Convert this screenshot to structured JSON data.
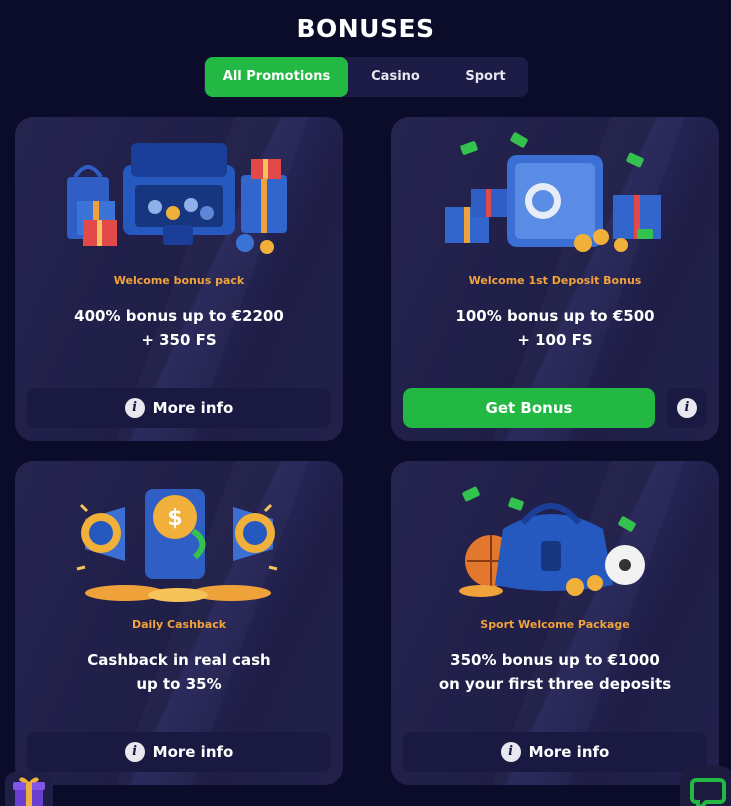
{
  "page": {
    "title": "BONUSES"
  },
  "tabs": [
    {
      "label": "All Promotions",
      "active": true
    },
    {
      "label": "Casino",
      "active": false
    },
    {
      "label": "Sport",
      "active": false
    }
  ],
  "cards": [
    {
      "label": "Welcome bonus pack",
      "line1": "400% bonus up to €2200",
      "line2": "+ 350 FS",
      "button": "More info",
      "illustration": "suitcase-gifts-icon"
    },
    {
      "label": "Welcome 1st Deposit Bonus",
      "line1": "100% bonus up to €500",
      "line2": "+ 100 FS",
      "button": "Get Bonus",
      "info_icon": "info-icon",
      "illustration": "safe-gifts-icon"
    },
    {
      "label": "Daily Cashback",
      "line1": "Cashback in real cash",
      "line2": "up to 35%",
      "button": "More info",
      "illustration": "megaphone-coins-icon"
    },
    {
      "label": "Sport Welcome Package",
      "line1": "350% bonus up to €1000",
      "line2": "on your first three deposits",
      "button": "More info",
      "illustration": "sport-bag-icon"
    }
  ],
  "info_glyph": "i",
  "widgets": {
    "gift": "gift-icon",
    "chat": "chat-icon"
  },
  "colors": {
    "background": "#0b0b2a",
    "accent_green": "#22b843",
    "label_orange": "#f2a33a",
    "card": "#22214b",
    "button_dark": "#1a1942"
  }
}
